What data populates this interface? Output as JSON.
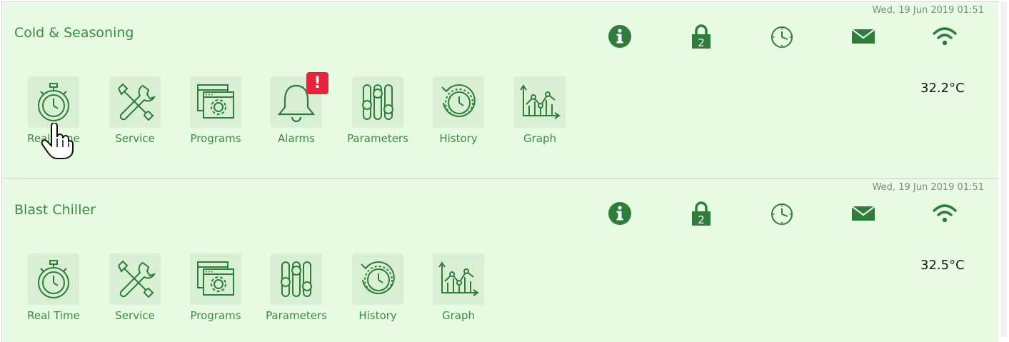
{
  "panels": [
    {
      "title": "Cold & Seasoning",
      "timestamp": "Wed, 19 Jun 2019 01:51",
      "temperature": "32.2°C",
      "status_icons": [
        "info-icon",
        "lock-icon",
        "clock-icon",
        "mail-icon",
        "wifi-icon"
      ],
      "lock_level": "2",
      "tiles": [
        {
          "label": "Real Time",
          "icon": "stopwatch-icon"
        },
        {
          "label": "Service",
          "icon": "tools-icon"
        },
        {
          "label": "Programs",
          "icon": "programs-icon"
        },
        {
          "label": "Alarms",
          "icon": "bell-icon",
          "badge": "!"
        },
        {
          "label": "Parameters",
          "icon": "sliders-icon"
        },
        {
          "label": "History",
          "icon": "history-icon"
        },
        {
          "label": "Graph",
          "icon": "graph-icon"
        }
      ]
    },
    {
      "title": "Blast Chiller",
      "timestamp": "Wed, 19 Jun 2019 01:51",
      "temperature": "32.5°C",
      "status_icons": [
        "info-icon",
        "lock-icon",
        "clock-icon",
        "mail-icon",
        "wifi-icon"
      ],
      "lock_level": "2",
      "tiles": [
        {
          "label": "Real Time",
          "icon": "stopwatch-icon"
        },
        {
          "label": "Service",
          "icon": "tools-icon"
        },
        {
          "label": "Programs",
          "icon": "programs-icon"
        },
        {
          "label": "Parameters",
          "icon": "sliders-icon"
        },
        {
          "label": "History",
          "icon": "history-icon"
        },
        {
          "label": "Graph",
          "icon": "graph-icon"
        }
      ]
    }
  ],
  "colors": {
    "panel_bg": "#e6fbe2",
    "accent": "#2e7d3a",
    "tile_bg": "#d9efd4",
    "badge": "#e8243c"
  }
}
